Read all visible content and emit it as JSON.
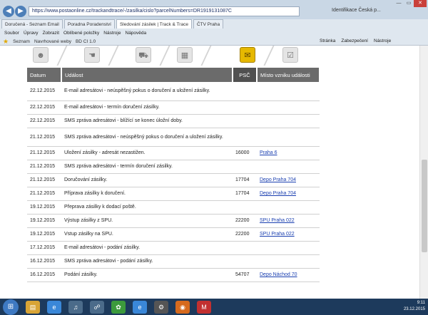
{
  "browser": {
    "address": "https://www.postaonline.cz/trackandtrace/-/zasilka/cislo?parcelNumbers=DR1919131087C",
    "address_right": "Identifikace Česká p...",
    "tabs": [
      {
        "label": "Doručená - Seznam Email",
        "active": false
      },
      {
        "label": "Poradna Poradenství",
        "active": false
      },
      {
        "label": "Sledování zásilek | Track & Trace",
        "active": true
      },
      {
        "label": "ČTV Praha",
        "active": false
      }
    ],
    "menu": [
      "Soubor",
      "Úpravy",
      "Zobrazit",
      "Oblíbené položky",
      "Nástroje",
      "Nápověda"
    ],
    "favorites": [
      "Seznam",
      "Navrhované weby",
      "BD CI 1.0"
    ],
    "right_tools": [
      "Stránka",
      "Zabezpečení",
      "Nástroje"
    ]
  },
  "steps": [
    {
      "icon": "person-icon",
      "glyph": "☻",
      "active": false
    },
    {
      "icon": "hand-icon",
      "glyph": "☚",
      "active": false
    },
    {
      "icon": "truck-icon",
      "glyph": "⛟",
      "active": false
    },
    {
      "icon": "building-icon",
      "glyph": "▦",
      "active": false
    },
    {
      "icon": "post-box-icon",
      "glyph": "✉",
      "active": true
    },
    {
      "icon": "package-check-icon",
      "glyph": "☑",
      "active": false
    }
  ],
  "table": {
    "headers": [
      "Datum",
      "Událost",
      "PSČ",
      "Místo vzniku události"
    ],
    "rows": [
      {
        "date": "22.12.2015",
        "event": "E-mail adresátovi - neúspěšný pokus o doručení a uložení zásilky.",
        "psc": "",
        "place": "",
        "tall": true
      },
      {
        "date": "22.12.2015",
        "event": "E-mail adresátovi - termín doručení zásilky.",
        "psc": "",
        "place": "",
        "tall": false
      },
      {
        "date": "22.12.2015",
        "event": "SMS zpráva adresátovi - blížící se konec úložní doby.",
        "psc": "",
        "place": "",
        "tall": false
      },
      {
        "date": "21.12.2015",
        "event": "SMS zpráva adresátovi - neúspěšný pokus o doručení a uložení zásilky.",
        "psc": "",
        "place": "",
        "tall": true
      },
      {
        "date": "21.12.2015",
        "event": "Uložení zásilky - adresát nezastižen.",
        "psc": "16000",
        "place": "Praha 6",
        "tall": false
      },
      {
        "date": "21.12.2015",
        "event": "SMS zpráva adresátovi - termín doručení zásilky.",
        "psc": "",
        "place": "",
        "tall": false
      },
      {
        "date": "21.12.2015",
        "event": "Doručování zásilky.",
        "psc": "17704",
        "place": "Depo Praha 704",
        "tall": false
      },
      {
        "date": "21.12.2015",
        "event": "Příprava zásilky k doručení.",
        "psc": "17704",
        "place": "Depo Praha 704",
        "tall": false
      },
      {
        "date": "19.12.2015",
        "event": "Přeprava zásilky k dodací poště.",
        "psc": "",
        "place": "",
        "tall": false
      },
      {
        "date": "19.12.2015",
        "event": "Výstup zásilky z SPU.",
        "psc": "22200",
        "place": "SPU Praha 022",
        "tall": false
      },
      {
        "date": "19.12.2015",
        "event": "Vstup zásilky na SPU.",
        "psc": "22200",
        "place": "SPU Praha 022",
        "tall": false
      },
      {
        "date": "17.12.2015",
        "event": "E-mail adresátovi - podání zásilky.",
        "psc": "",
        "place": "",
        "tall": false
      },
      {
        "date": "16.12.2015",
        "event": "SMS zpráva adresátovi - podání zásilky.",
        "psc": "",
        "place": "",
        "tall": false
      },
      {
        "date": "16.12.2015",
        "event": "Podání zásilky.",
        "psc": "54707",
        "place": "Depo Náchod 70",
        "tall": false
      }
    ]
  },
  "taskbar": {
    "clock_time": "9:11",
    "clock_date": "23.12.2015",
    "apps": [
      {
        "icon": "folder-icon",
        "glyph": "▤",
        "color": "#d8a436"
      },
      {
        "icon": "internet-explorer-icon",
        "glyph": "e",
        "color": "#3a87d8"
      },
      {
        "icon": "media-icon",
        "glyph": "♫",
        "color": "#4b6b8a"
      },
      {
        "icon": "network-icon",
        "glyph": "☍",
        "color": "#4b6b8a"
      },
      {
        "icon": "icq-icon",
        "glyph": "✿",
        "color": "#3c9a3c"
      },
      {
        "icon": "ie-icon",
        "glyph": "e",
        "color": "#3a87d8"
      },
      {
        "icon": "settings-icon",
        "glyph": "⚙",
        "color": "#555"
      },
      {
        "icon": "firefox-icon",
        "glyph": "◉",
        "color": "#d66a1e"
      },
      {
        "icon": "mail-icon",
        "glyph": "M",
        "color": "#c23030"
      }
    ]
  }
}
